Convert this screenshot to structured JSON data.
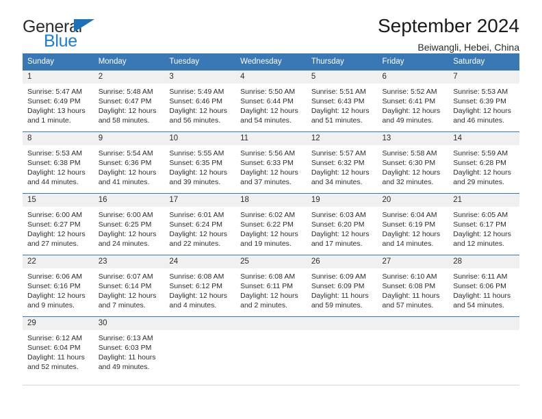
{
  "brand": {
    "name_top": "General",
    "name_bottom": "Blue",
    "accent_color": "#1a7fd4",
    "triangle_color": "#1a73b8"
  },
  "header": {
    "title": "September 2024",
    "subtitle": "Beiwangli, Hebei, China"
  },
  "calendar": {
    "header_bg": "#3a77b5",
    "daynum_bg": "#f0f0f0",
    "weekday_headers": [
      "Sunday",
      "Monday",
      "Tuesday",
      "Wednesday",
      "Thursday",
      "Friday",
      "Saturday"
    ],
    "weeks": [
      [
        {
          "day": "1",
          "sunrise": "Sunrise: 5:47 AM",
          "sunset": "Sunset: 6:49 PM",
          "daylight_line1": "Daylight: 13 hours",
          "daylight_line2": "and 1 minute."
        },
        {
          "day": "2",
          "sunrise": "Sunrise: 5:48 AM",
          "sunset": "Sunset: 6:47 PM",
          "daylight_line1": "Daylight: 12 hours",
          "daylight_line2": "and 58 minutes."
        },
        {
          "day": "3",
          "sunrise": "Sunrise: 5:49 AM",
          "sunset": "Sunset: 6:46 PM",
          "daylight_line1": "Daylight: 12 hours",
          "daylight_line2": "and 56 minutes."
        },
        {
          "day": "4",
          "sunrise": "Sunrise: 5:50 AM",
          "sunset": "Sunset: 6:44 PM",
          "daylight_line1": "Daylight: 12 hours",
          "daylight_line2": "and 54 minutes."
        },
        {
          "day": "5",
          "sunrise": "Sunrise: 5:51 AM",
          "sunset": "Sunset: 6:43 PM",
          "daylight_line1": "Daylight: 12 hours",
          "daylight_line2": "and 51 minutes."
        },
        {
          "day": "6",
          "sunrise": "Sunrise: 5:52 AM",
          "sunset": "Sunset: 6:41 PM",
          "daylight_line1": "Daylight: 12 hours",
          "daylight_line2": "and 49 minutes."
        },
        {
          "day": "7",
          "sunrise": "Sunrise: 5:53 AM",
          "sunset": "Sunset: 6:39 PM",
          "daylight_line1": "Daylight: 12 hours",
          "daylight_line2": "and 46 minutes."
        }
      ],
      [
        {
          "day": "8",
          "sunrise": "Sunrise: 5:53 AM",
          "sunset": "Sunset: 6:38 PM",
          "daylight_line1": "Daylight: 12 hours",
          "daylight_line2": "and 44 minutes."
        },
        {
          "day": "9",
          "sunrise": "Sunrise: 5:54 AM",
          "sunset": "Sunset: 6:36 PM",
          "daylight_line1": "Daylight: 12 hours",
          "daylight_line2": "and 41 minutes."
        },
        {
          "day": "10",
          "sunrise": "Sunrise: 5:55 AM",
          "sunset": "Sunset: 6:35 PM",
          "daylight_line1": "Daylight: 12 hours",
          "daylight_line2": "and 39 minutes."
        },
        {
          "day": "11",
          "sunrise": "Sunrise: 5:56 AM",
          "sunset": "Sunset: 6:33 PM",
          "daylight_line1": "Daylight: 12 hours",
          "daylight_line2": "and 37 minutes."
        },
        {
          "day": "12",
          "sunrise": "Sunrise: 5:57 AM",
          "sunset": "Sunset: 6:32 PM",
          "daylight_line1": "Daylight: 12 hours",
          "daylight_line2": "and 34 minutes."
        },
        {
          "day": "13",
          "sunrise": "Sunrise: 5:58 AM",
          "sunset": "Sunset: 6:30 PM",
          "daylight_line1": "Daylight: 12 hours",
          "daylight_line2": "and 32 minutes."
        },
        {
          "day": "14",
          "sunrise": "Sunrise: 5:59 AM",
          "sunset": "Sunset: 6:28 PM",
          "daylight_line1": "Daylight: 12 hours",
          "daylight_line2": "and 29 minutes."
        }
      ],
      [
        {
          "day": "15",
          "sunrise": "Sunrise: 6:00 AM",
          "sunset": "Sunset: 6:27 PM",
          "daylight_line1": "Daylight: 12 hours",
          "daylight_line2": "and 27 minutes."
        },
        {
          "day": "16",
          "sunrise": "Sunrise: 6:00 AM",
          "sunset": "Sunset: 6:25 PM",
          "daylight_line1": "Daylight: 12 hours",
          "daylight_line2": "and 24 minutes."
        },
        {
          "day": "17",
          "sunrise": "Sunrise: 6:01 AM",
          "sunset": "Sunset: 6:24 PM",
          "daylight_line1": "Daylight: 12 hours",
          "daylight_line2": "and 22 minutes."
        },
        {
          "day": "18",
          "sunrise": "Sunrise: 6:02 AM",
          "sunset": "Sunset: 6:22 PM",
          "daylight_line1": "Daylight: 12 hours",
          "daylight_line2": "and 19 minutes."
        },
        {
          "day": "19",
          "sunrise": "Sunrise: 6:03 AM",
          "sunset": "Sunset: 6:20 PM",
          "daylight_line1": "Daylight: 12 hours",
          "daylight_line2": "and 17 minutes."
        },
        {
          "day": "20",
          "sunrise": "Sunrise: 6:04 AM",
          "sunset": "Sunset: 6:19 PM",
          "daylight_line1": "Daylight: 12 hours",
          "daylight_line2": "and 14 minutes."
        },
        {
          "day": "21",
          "sunrise": "Sunrise: 6:05 AM",
          "sunset": "Sunset: 6:17 PM",
          "daylight_line1": "Daylight: 12 hours",
          "daylight_line2": "and 12 minutes."
        }
      ],
      [
        {
          "day": "22",
          "sunrise": "Sunrise: 6:06 AM",
          "sunset": "Sunset: 6:16 PM",
          "daylight_line1": "Daylight: 12 hours",
          "daylight_line2": "and 9 minutes."
        },
        {
          "day": "23",
          "sunrise": "Sunrise: 6:07 AM",
          "sunset": "Sunset: 6:14 PM",
          "daylight_line1": "Daylight: 12 hours",
          "daylight_line2": "and 7 minutes."
        },
        {
          "day": "24",
          "sunrise": "Sunrise: 6:08 AM",
          "sunset": "Sunset: 6:12 PM",
          "daylight_line1": "Daylight: 12 hours",
          "daylight_line2": "and 4 minutes."
        },
        {
          "day": "25",
          "sunrise": "Sunrise: 6:08 AM",
          "sunset": "Sunset: 6:11 PM",
          "daylight_line1": "Daylight: 12 hours",
          "daylight_line2": "and 2 minutes."
        },
        {
          "day": "26",
          "sunrise": "Sunrise: 6:09 AM",
          "sunset": "Sunset: 6:09 PM",
          "daylight_line1": "Daylight: 11 hours",
          "daylight_line2": "and 59 minutes."
        },
        {
          "day": "27",
          "sunrise": "Sunrise: 6:10 AM",
          "sunset": "Sunset: 6:08 PM",
          "daylight_line1": "Daylight: 11 hours",
          "daylight_line2": "and 57 minutes."
        },
        {
          "day": "28",
          "sunrise": "Sunrise: 6:11 AM",
          "sunset": "Sunset: 6:06 PM",
          "daylight_line1": "Daylight: 11 hours",
          "daylight_line2": "and 54 minutes."
        }
      ],
      [
        {
          "day": "29",
          "sunrise": "Sunrise: 6:12 AM",
          "sunset": "Sunset: 6:04 PM",
          "daylight_line1": "Daylight: 11 hours",
          "daylight_line2": "and 52 minutes."
        },
        {
          "day": "30",
          "sunrise": "Sunrise: 6:13 AM",
          "sunset": "Sunset: 6:03 PM",
          "daylight_line1": "Daylight: 11 hours",
          "daylight_line2": "and 49 minutes."
        },
        {
          "day": "",
          "sunrise": "",
          "sunset": "",
          "daylight_line1": "",
          "daylight_line2": ""
        },
        {
          "day": "",
          "sunrise": "",
          "sunset": "",
          "daylight_line1": "",
          "daylight_line2": ""
        },
        {
          "day": "",
          "sunrise": "",
          "sunset": "",
          "daylight_line1": "",
          "daylight_line2": ""
        },
        {
          "day": "",
          "sunrise": "",
          "sunset": "",
          "daylight_line1": "",
          "daylight_line2": ""
        },
        {
          "day": "",
          "sunrise": "",
          "sunset": "",
          "daylight_line1": "",
          "daylight_line2": ""
        }
      ]
    ]
  }
}
